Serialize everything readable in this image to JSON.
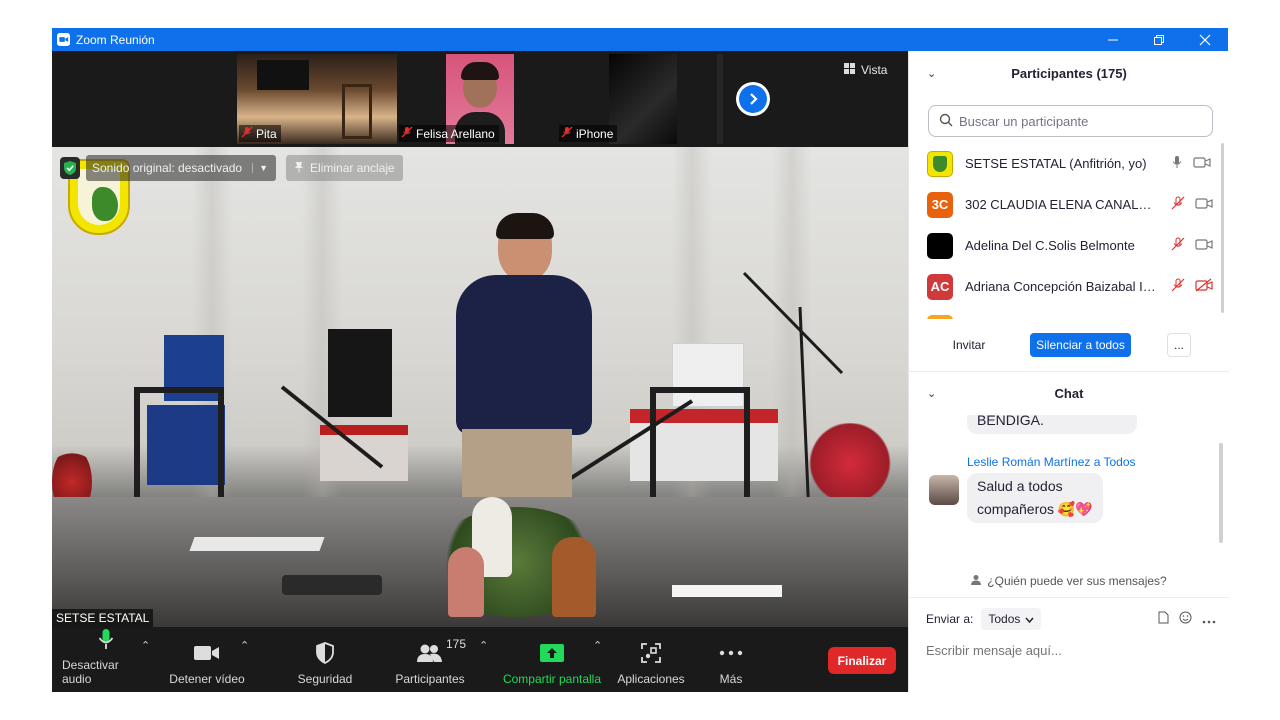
{
  "window": {
    "title": "Zoom Reunión",
    "controls": [
      "minimize-icon",
      "restore-icon",
      "close-icon"
    ]
  },
  "gallery_strip": {
    "thumbnails": [
      {
        "name": "Pita",
        "muted": true
      },
      {
        "name": "Felisa Arellano",
        "muted": true
      },
      {
        "name": "iPhone",
        "muted": true
      }
    ],
    "view_label": "Vista"
  },
  "main_video": {
    "original_sound_label": "Sonido original: desactivado",
    "unpin_label": "Eliminar anclaje",
    "speaker_name": "SETSE ESTATAL"
  },
  "toolbar": {
    "mute": "Desactivar audio",
    "video": "Detener vídeo",
    "security": "Seguridad",
    "participants": "Participantes",
    "participants_count": "175",
    "share": "Compartir pantalla",
    "apps": "Aplicaciones",
    "more": "Más",
    "end": "Finalizar"
  },
  "participants_panel": {
    "title": "Participantes (175)",
    "search_placeholder": "Buscar un participante",
    "rows": [
      {
        "name": "SETSE ESTATAL (Anfitrión, yo)",
        "initials": "",
        "avatar_color": "#f2e600",
        "mic_muted": false,
        "video_off": false
      },
      {
        "name": "302 CLAUDIA ELENA CANALES ...",
        "initials": "3C",
        "avatar_color": "#e8620c",
        "mic_muted": true,
        "video_off": false
      },
      {
        "name": "Adelina Del C.Solis Belmonte",
        "initials": "",
        "avatar_color": "#000000",
        "mic_muted": true,
        "video_off": false
      },
      {
        "name": "Adriana Concepción Baizabal Ib...",
        "initials": "AC",
        "avatar_color": "#d03a3a",
        "mic_muted": true,
        "video_off": true
      }
    ],
    "invite": "Invitar",
    "mute_all": "Silenciar a todos",
    "more": "..."
  },
  "chat_panel": {
    "title": "Chat",
    "messages": [
      {
        "text": "BENDIGA."
      },
      {
        "sender": "Leslie Román Martínez a Todos",
        "line1": "Salud a todos",
        "line2": "compañeros 🥰💖"
      }
    ],
    "who_can_see": "¿Quién puede ver sus mensajes?",
    "send_to_label": "Enviar a:",
    "send_to_value": "Todos",
    "input_placeholder": "Escribir mensaje aquí..."
  },
  "colors": {
    "zoom_blue": "#0e71eb",
    "end_red": "#e02828",
    "share_green": "#23d959",
    "muted_red": "#e0302f"
  }
}
